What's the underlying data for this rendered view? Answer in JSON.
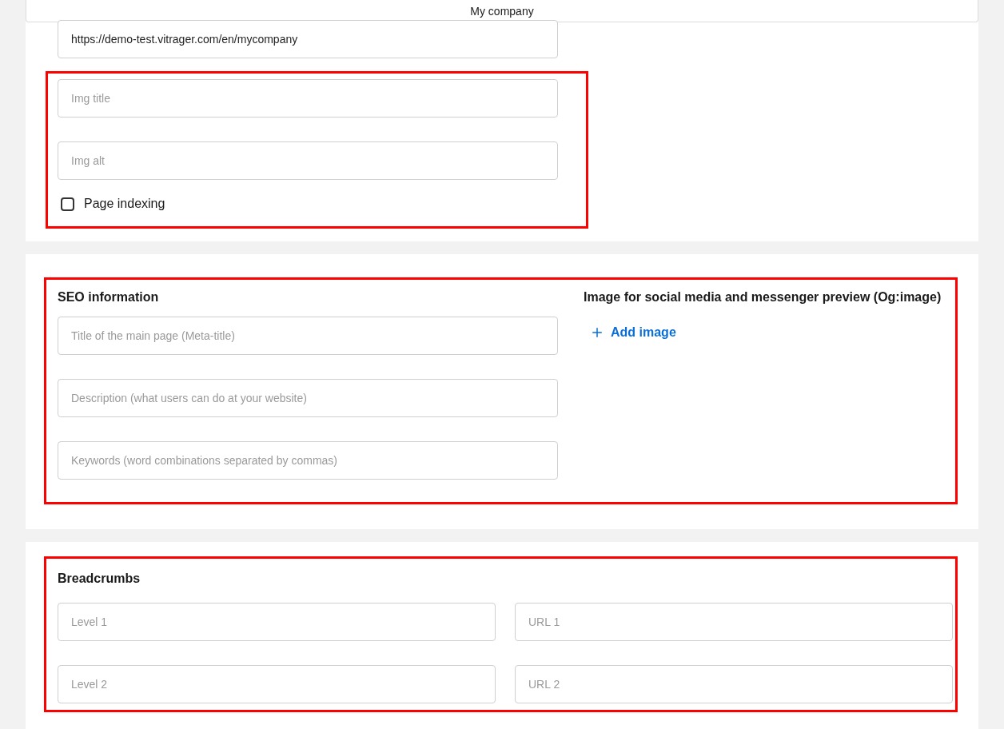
{
  "header": {
    "title": "My company"
  },
  "general": {
    "url_field": {
      "value": "https://demo-test.vitrager.com/en/mycompany"
    },
    "img_title": {
      "placeholder": "Img title"
    },
    "img_alt": {
      "placeholder": "Img alt"
    },
    "page_indexing": {
      "label": "Page indexing",
      "checked": false
    }
  },
  "seo": {
    "heading": "SEO information",
    "fields": [
      {
        "placeholder": "Title of the main page (Meta-title)"
      },
      {
        "placeholder": "Description (what users can do at your website)"
      },
      {
        "placeholder": "Keywords (word combinations separated by commas)"
      }
    ]
  },
  "og_image": {
    "heading": "Image for social media and messenger preview (Og:image)",
    "add_button": "Add image"
  },
  "breadcrumbs": {
    "heading": "Breadcrumbs",
    "rows": [
      {
        "level": {
          "placeholder": "Level 1"
        },
        "url": {
          "placeholder": "URL 1"
        }
      },
      {
        "level": {
          "placeholder": "Level 2"
        },
        "url": {
          "placeholder": "URL 2"
        }
      }
    ]
  }
}
